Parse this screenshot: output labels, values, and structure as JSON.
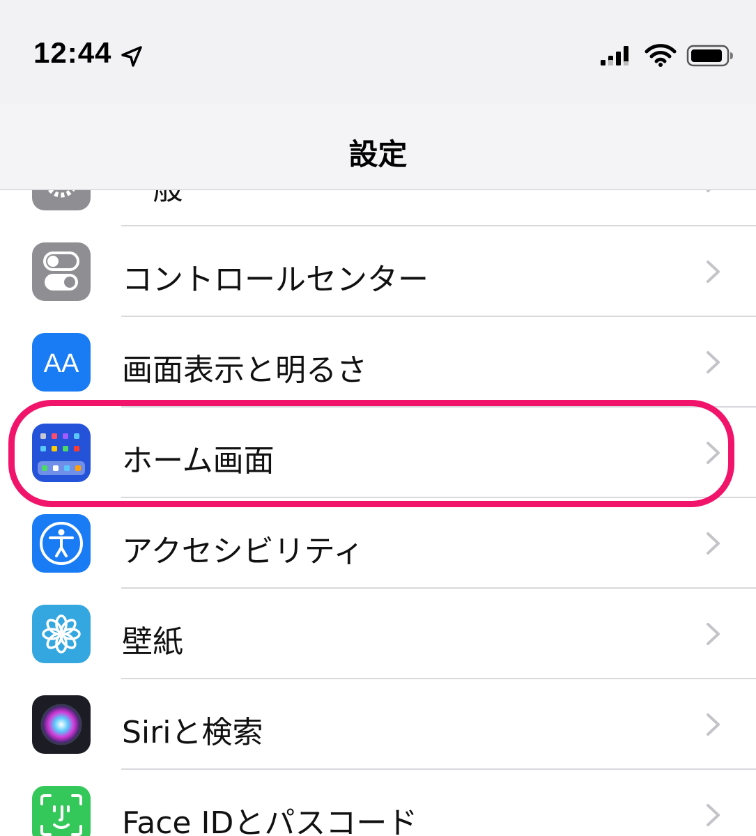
{
  "status_bar": {
    "time": "12:44",
    "icons": [
      "location-arrow-icon",
      "cellular-signal-icon",
      "wifi-icon",
      "battery-icon"
    ]
  },
  "nav": {
    "title": "設定"
  },
  "rows": [
    {
      "label": "一般",
      "icon": "gear-icon",
      "color": "#8e8e93"
    },
    {
      "label": "コントロールセンター",
      "icon": "toggle-switches-icon",
      "color": "#8e8e93"
    },
    {
      "label": "画面表示と明るさ",
      "icon": "text-size-icon",
      "icon_text": "AA",
      "color": "#1a7cf5"
    },
    {
      "label": "ホーム画面",
      "icon": "home-screen-grid-icon",
      "color": "#2452d9"
    },
    {
      "label": "アクセシビリティ",
      "icon": "accessibility-person-icon",
      "color": "#1a7cf5"
    },
    {
      "label": "壁紙",
      "icon": "flower-icon",
      "color": "#35a7e0"
    },
    {
      "label": "Siriと検索",
      "icon": "siri-icon",
      "color": "#1c1c24"
    },
    {
      "label": "Face IDとパスコード",
      "icon": "face-id-icon",
      "color": "#34c759"
    }
  ],
  "highlight": {
    "color": "#f0146a",
    "target": "ホーム画面"
  }
}
